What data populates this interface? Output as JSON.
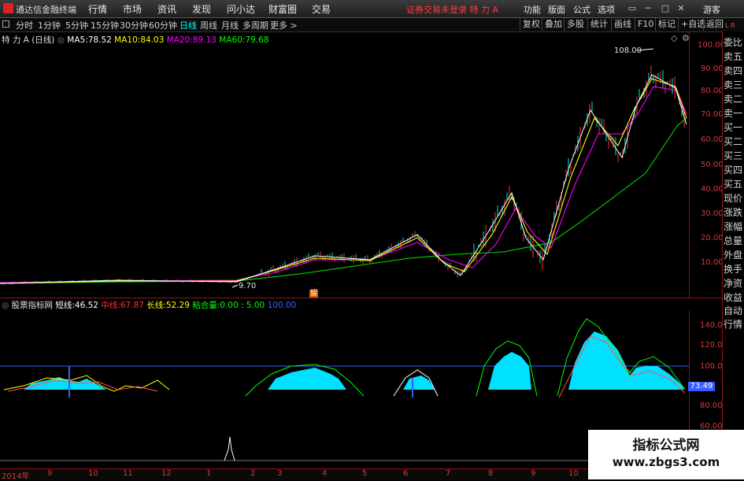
{
  "titlebar": {
    "app_title": "通达信金融终端",
    "menu": [
      "行情",
      "市场",
      "资讯",
      "发现",
      "问小达",
      "财富圈",
      "交易"
    ],
    "status": "证券交易未登录  特 力 A",
    "right_menu": [
      "功能",
      "版面",
      "公式",
      "选项"
    ],
    "user": "游客"
  },
  "toolbar": {
    "periods": [
      "分时",
      "1分钟",
      "5分钟",
      "15分钟",
      "30分钟",
      "60分钟",
      "日线",
      "周线",
      "月线",
      "多周期",
      "更多 >"
    ],
    "active_period": "日线",
    "buttons": [
      "复权",
      "叠加",
      "多股",
      "统计",
      "画线",
      "F10",
      "标记",
      "+自选",
      "返回"
    ]
  },
  "main_chart": {
    "stock_label": "特 力 A",
    "period_label": "(日线)",
    "ma": [
      {
        "name": "MA5",
        "value": "78.52",
        "color": "#ffffff"
      },
      {
        "name": "MA10",
        "value": "84.03",
        "color": "#ffff00"
      },
      {
        "name": "MA20",
        "value": "89.13",
        "color": "#ff00ff"
      },
      {
        "name": "MA60",
        "value": "79.68",
        "color": "#00ff00"
      }
    ],
    "high_label": "108.00",
    "low_label": "9.70",
    "event_marker": "留",
    "y_ticks": [
      "100.00",
      "90.00",
      "80.00",
      "70.00",
      "60.00",
      "50.00",
      "40.00",
      "30.00",
      "20.00",
      "10.00"
    ]
  },
  "indicator": {
    "name": "股票指标网",
    "lines": [
      {
        "name": "短线",
        "value": "46.52",
        "color": "#ffffff"
      },
      {
        "name": "中线",
        "value": "67.87",
        "color": "#ff3333"
      },
      {
        "name": "长线",
        "value": "52.29",
        "color": "#ffff00"
      },
      {
        "name": "粘合量",
        "value": "0.00 : 5.00",
        "color": "#00ff00"
      },
      {
        "name": "",
        "value": "100.00",
        "color": "#3a5cff"
      }
    ],
    "y_ticks": [
      "140.0",
      "120.0",
      "100.0",
      "80.00",
      "60.00"
    ],
    "current_value": "73.49"
  },
  "right_panel": {
    "items": [
      "委比",
      "卖五",
      "卖四",
      "卖三",
      "卖二",
      "卖一",
      "买一",
      "买二",
      "买三",
      "买四",
      "买五",
      "现价",
      "涨跌",
      "涨幅",
      "总量",
      "外盘",
      "换手",
      "净资",
      "收益"
    ],
    "bottom_items": [
      "自动",
      "行情"
    ],
    "corner": "L R"
  },
  "date_axis": [
    "2014年",
    "9",
    "10",
    "11",
    "12",
    "1",
    "2",
    "3",
    "4",
    "5",
    "6",
    "7",
    "8",
    "9",
    "10"
  ],
  "watermark": {
    "title": "指标公式网",
    "url": "www.zbgs3.com"
  }
}
